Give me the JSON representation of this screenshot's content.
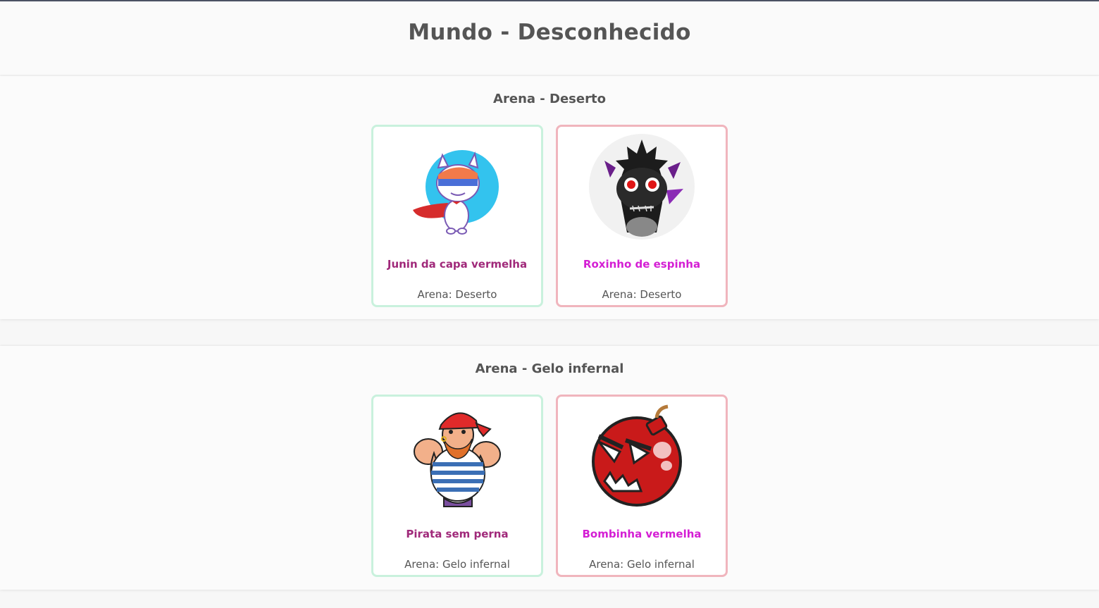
{
  "page_title": "Mundo - Desconhecido",
  "arenas": [
    {
      "title": "Arena - Deserto",
      "cards": [
        {
          "name": "Junin da capa vermelha",
          "arena": "Arena: Deserto",
          "border": "green",
          "icon": "caped-cat-hero"
        },
        {
          "name": "Roxinho de espinha",
          "arena": "Arena: Deserto",
          "border": "red",
          "icon": "black-spiky-monster"
        }
      ]
    },
    {
      "title": "Arena - Gelo infernal",
      "cards": [
        {
          "name": "Pirata sem perna",
          "arena": "Arena: Gelo infernal",
          "border": "green",
          "icon": "pirate"
        },
        {
          "name": "Bombinha vermelha",
          "arena": "Arena: Gelo infernal",
          "border": "red",
          "icon": "red-bomb"
        }
      ]
    }
  ],
  "colors": {
    "green_border": "#c9f1dd",
    "red_border": "#f0b5bd",
    "name_green": "#a0297a",
    "name_red": "#d41ed4"
  }
}
